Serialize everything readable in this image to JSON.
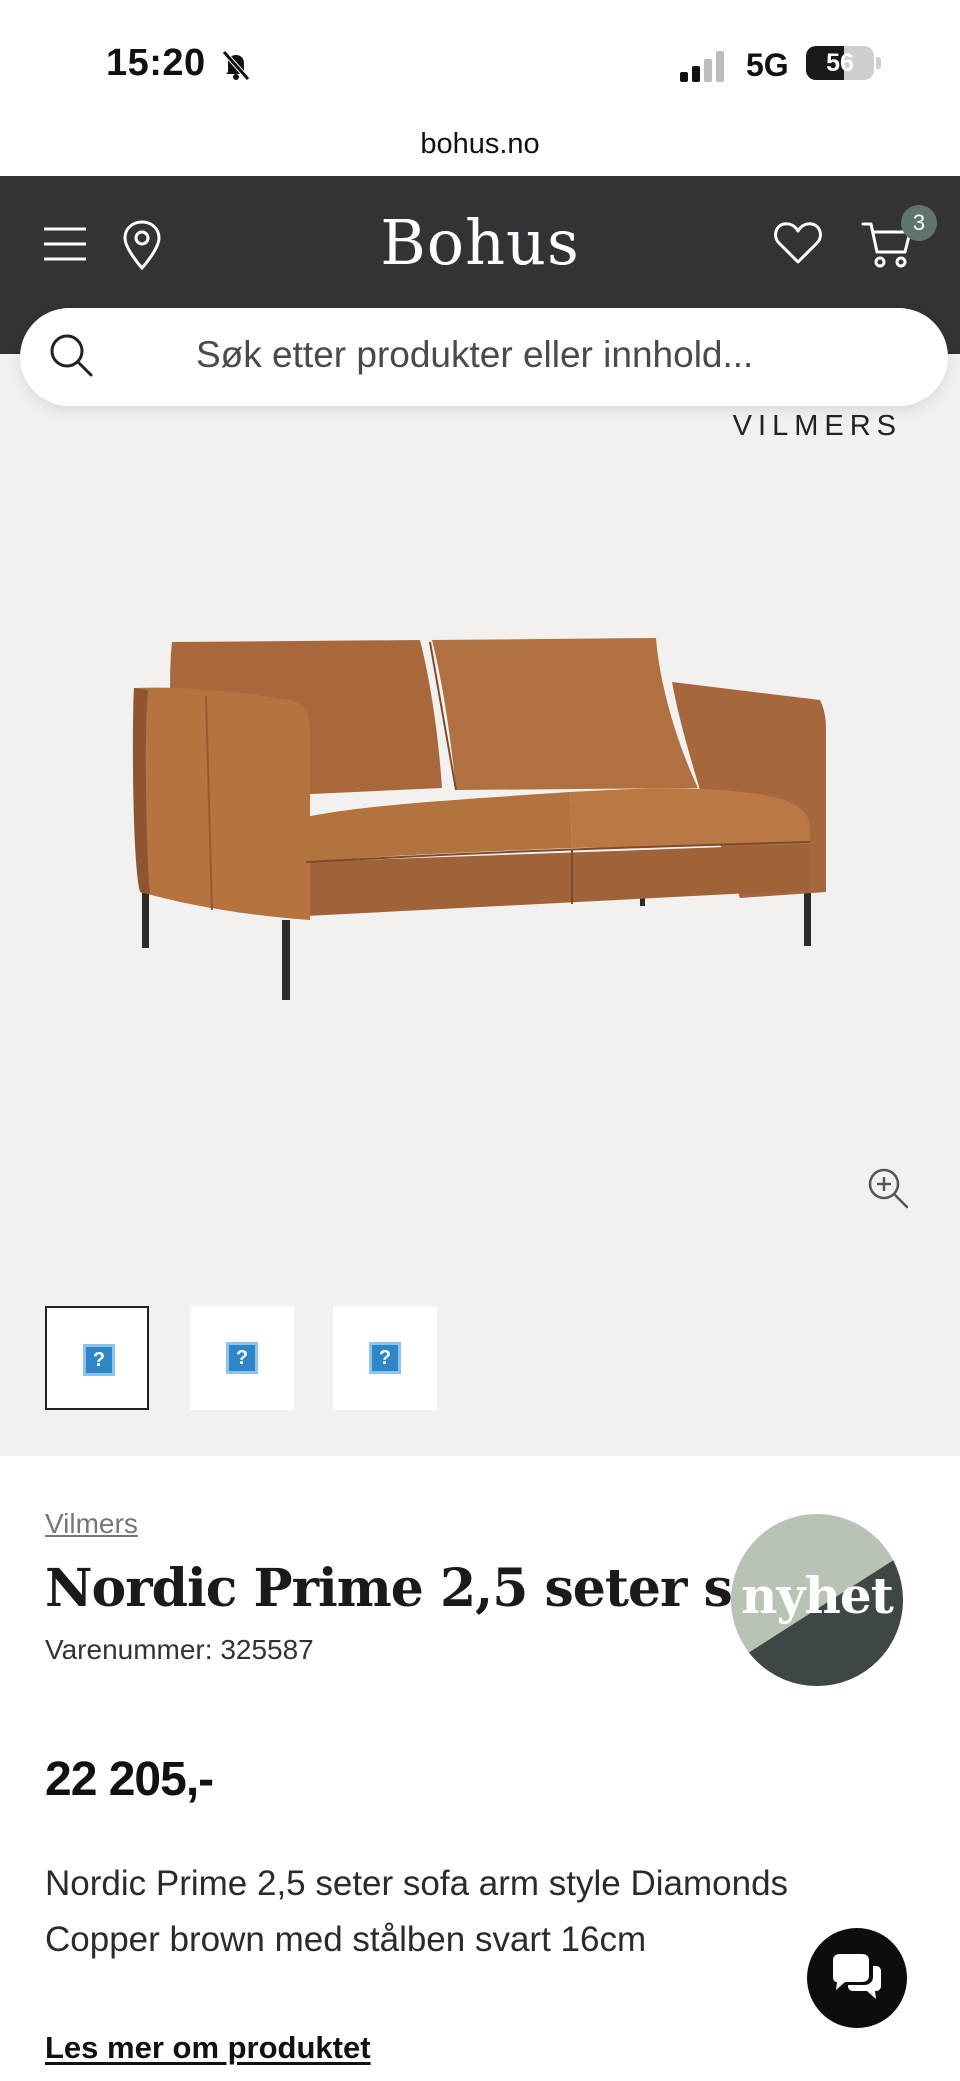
{
  "status_bar": {
    "time": "15:20",
    "network": "5G",
    "battery": "56",
    "battery_level": 0.56,
    "icons": [
      "bell-slash-icon",
      "signal-icon",
      "battery-icon"
    ]
  },
  "browser": {
    "url": "bohus.no"
  },
  "header": {
    "logo": "Bohus",
    "cart_count": "3",
    "icons": [
      "menu-icon",
      "location-icon",
      "heart-icon",
      "cart-icon"
    ],
    "background_color": "#323237"
  },
  "search": {
    "placeholder": "Søk etter produkter eller innhold..."
  },
  "gallery": {
    "brand_watermark": "VILMERS",
    "selected_thumbnail": 0,
    "thumbnail_count": 3,
    "thumbnail_placeholder": "?",
    "icons": [
      "zoom-in-icon"
    ]
  },
  "product": {
    "brand": "Vilmers",
    "title": "Nordic Prime 2,5 seter sofa",
    "sku": "Varenummer: 325587",
    "badge": "nyhet",
    "price": "22 205,-",
    "description": "Nordic Prime 2,5 seter sofa arm style Diamonds Copper brown med stålben svart 16cm",
    "read_more": "Les mer om produktet",
    "badge_colors": [
      "#b9c3b4",
      "#3f4746"
    ]
  },
  "chat": {
    "icon": "chat-bubbles-icon"
  }
}
